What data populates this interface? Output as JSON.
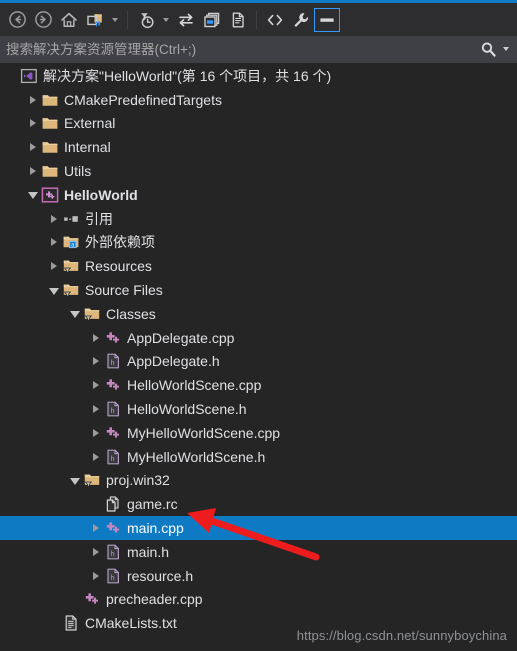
{
  "window": {
    "accent_color": "#0e7ac4",
    "background": "#252526",
    "toolbar_background": "#2d2d30",
    "selection_color": "#0e7ac4",
    "folder_color": "#dcb67a",
    "cpp_icon_color": "#c586c0",
    "text_color": "#dfe0e2"
  },
  "toolbar": {
    "buttons": [
      {
        "name": "back-button",
        "icon": "arrow-left-circle-icon",
        "label": "后退"
      },
      {
        "name": "forward-button",
        "icon": "arrow-right-circle-icon",
        "label": "前进"
      },
      {
        "name": "home-button",
        "icon": "home-icon",
        "label": "主页"
      },
      {
        "name": "show-all-files-button",
        "icon": "show-all-files-icon",
        "label": "显示所有文件"
      },
      {
        "name": "show-all-files-dropdown",
        "icon": "chevron-down-icon",
        "label": ""
      },
      {
        "name": "pending-changes-filter-button",
        "icon": "pending-changes-icon",
        "label": "挂起的更改筛选器"
      },
      {
        "name": "pending-changes-dropdown",
        "icon": "chevron-down-icon",
        "label": ""
      },
      {
        "name": "sync-with-active-document-button",
        "icon": "sync-arrows-icon",
        "label": "与活动文档同步"
      },
      {
        "name": "refresh-button",
        "icon": "refresh-windows-icon",
        "label": "刷新"
      },
      {
        "name": "collapse-all-button",
        "icon": "collapse-all-icon",
        "label": "全部折叠"
      },
      {
        "name": "view-code-button",
        "icon": "code-brackets-icon",
        "label": "查看代码"
      },
      {
        "name": "properties-button",
        "icon": "wrench-icon",
        "label": "属性"
      },
      {
        "name": "preview-selected-items-button",
        "icon": "preview-pane-icon",
        "label": "预览选定的项",
        "active": true
      }
    ]
  },
  "search": {
    "placeholder": "搜索解决方案资源管理器(Ctrl+;)",
    "value": "",
    "icon": "search-icon",
    "dropdown_icon": "chevron-down-icon"
  },
  "tree": {
    "items": [
      {
        "label": "解决方案\"HelloWorld\"(第 16 个项目，共 16 个)",
        "depth": 0,
        "twisty": "none",
        "icon": "solution-icon",
        "bold": false,
        "selected": false,
        "name": "tree-item-solution"
      },
      {
        "label": "CMakePredefinedTargets",
        "depth": 1,
        "twisty": "collapsed",
        "icon": "folder-icon",
        "bold": false,
        "selected": false,
        "name": "tree-item-cmakepredefinedtargets"
      },
      {
        "label": "External",
        "depth": 1,
        "twisty": "collapsed",
        "icon": "folder-icon",
        "bold": false,
        "selected": false,
        "name": "tree-item-external"
      },
      {
        "label": "Internal",
        "depth": 1,
        "twisty": "collapsed",
        "icon": "folder-icon",
        "bold": false,
        "selected": false,
        "name": "tree-item-internal"
      },
      {
        "label": "Utils",
        "depth": 1,
        "twisty": "collapsed",
        "icon": "folder-icon",
        "bold": false,
        "selected": false,
        "name": "tree-item-utils"
      },
      {
        "label": "HelloWorld",
        "depth": 1,
        "twisty": "expanded",
        "icon": "cpp-project-icon",
        "bold": true,
        "selected": false,
        "name": "tree-item-helloworld-project"
      },
      {
        "label": "引用",
        "depth": 2,
        "twisty": "collapsed",
        "icon": "references-icon",
        "bold": false,
        "selected": false,
        "name": "tree-item-references"
      },
      {
        "label": "外部依赖项",
        "depth": 2,
        "twisty": "collapsed",
        "icon": "external-dependencies-icon",
        "bold": false,
        "selected": false,
        "name": "tree-item-external-dependencies"
      },
      {
        "label": "Resources",
        "depth": 2,
        "twisty": "collapsed",
        "icon": "filter-folder-icon",
        "bold": false,
        "selected": false,
        "name": "tree-item-resources"
      },
      {
        "label": "Source Files",
        "depth": 2,
        "twisty": "expanded",
        "icon": "filter-folder-icon",
        "bold": false,
        "selected": false,
        "name": "tree-item-source-files"
      },
      {
        "label": "Classes",
        "depth": 3,
        "twisty": "expanded",
        "icon": "filter-folder-icon",
        "bold": false,
        "selected": false,
        "name": "tree-item-classes"
      },
      {
        "label": "AppDelegate.cpp",
        "depth": 4,
        "twisty": "collapsed",
        "icon": "cpp-file-icon",
        "bold": false,
        "selected": false,
        "name": "tree-item-appdelegate-cpp"
      },
      {
        "label": "AppDelegate.h",
        "depth": 4,
        "twisty": "collapsed",
        "icon": "header-file-icon",
        "bold": false,
        "selected": false,
        "name": "tree-item-appdelegate-h"
      },
      {
        "label": "HelloWorldScene.cpp",
        "depth": 4,
        "twisty": "collapsed",
        "icon": "cpp-file-icon",
        "bold": false,
        "selected": false,
        "name": "tree-item-helloworldscene-cpp"
      },
      {
        "label": "HelloWorldScene.h",
        "depth": 4,
        "twisty": "collapsed",
        "icon": "header-file-icon",
        "bold": false,
        "selected": false,
        "name": "tree-item-helloworldscene-h"
      },
      {
        "label": "MyHelloWorldScene.cpp",
        "depth": 4,
        "twisty": "collapsed",
        "icon": "cpp-file-icon",
        "bold": false,
        "selected": false,
        "name": "tree-item-myhelloworldscene-cpp"
      },
      {
        "label": "MyHelloWorldScene.h",
        "depth": 4,
        "twisty": "collapsed",
        "icon": "header-file-icon",
        "bold": false,
        "selected": false,
        "name": "tree-item-myhelloworldscene-h"
      },
      {
        "label": "proj.win32",
        "depth": 3,
        "twisty": "expanded",
        "icon": "filter-folder-icon",
        "bold": false,
        "selected": false,
        "name": "tree-item-proj-win32"
      },
      {
        "label": "game.rc",
        "depth": 4,
        "twisty": "none",
        "icon": "resource-file-icon",
        "bold": false,
        "selected": false,
        "name": "tree-item-game-rc"
      },
      {
        "label": "main.cpp",
        "depth": 4,
        "twisty": "collapsed",
        "icon": "cpp-file-icon",
        "bold": false,
        "selected": true,
        "name": "tree-item-main-cpp"
      },
      {
        "label": "main.h",
        "depth": 4,
        "twisty": "collapsed",
        "icon": "header-file-icon",
        "bold": false,
        "selected": false,
        "name": "tree-item-main-h"
      },
      {
        "label": "resource.h",
        "depth": 4,
        "twisty": "collapsed",
        "icon": "header-file-icon",
        "bold": false,
        "selected": false,
        "name": "tree-item-resource-h"
      },
      {
        "label": "precheader.cpp",
        "depth": 3,
        "twisty": "none",
        "icon": "cpp-file-icon",
        "bold": false,
        "selected": false,
        "name": "tree-item-precheader-cpp"
      },
      {
        "label": "CMakeLists.txt",
        "depth": 2,
        "twisty": "none",
        "icon": "text-file-icon",
        "bold": false,
        "selected": false,
        "name": "tree-item-cmakelists-txt"
      }
    ]
  },
  "annotation": {
    "arrow_color": "#ee1c1c",
    "points_at": "main.cpp"
  },
  "watermark": {
    "text": "https://blog.csdn.net/sunnyboychina"
  }
}
